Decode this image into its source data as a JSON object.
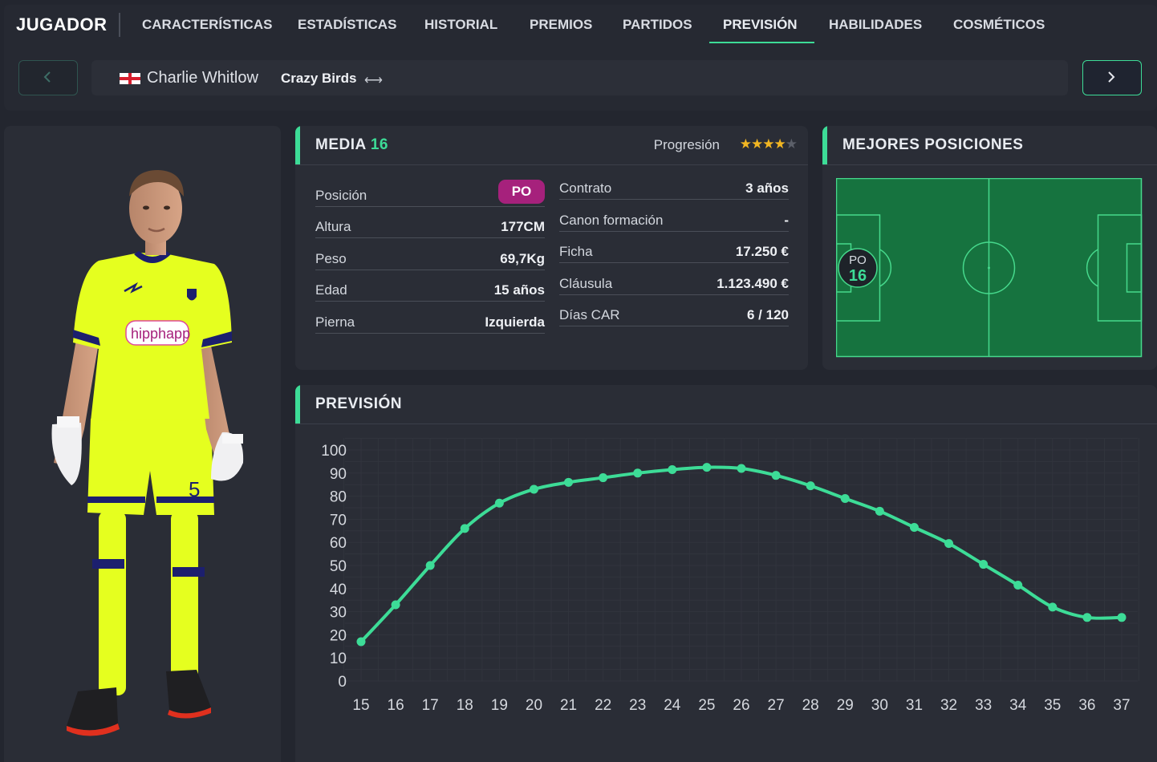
{
  "nav": {
    "title": "JUGADOR",
    "tabs": [
      {
        "label": "CARACTERÍSTICAS"
      },
      {
        "label": "ESTADÍSTICAS"
      },
      {
        "label": "HISTORIAL"
      },
      {
        "label": "PREMIOS"
      },
      {
        "label": "PARTIDOS"
      },
      {
        "label": "PREVISIÓN",
        "active": true
      },
      {
        "label": "HABILIDADES"
      },
      {
        "label": "COSMÉTICOS"
      }
    ]
  },
  "player": {
    "name": "Charlie Whitlow",
    "team": "Crazy Birds",
    "flag": "england-flag",
    "swap_icon": "⟷",
    "kit": {
      "number": "5",
      "sponsor": "hipphapp",
      "shirt_color": "#e5ff1f",
      "trim_color": "#1c1f6e"
    }
  },
  "media": {
    "title": "MEDIA",
    "value": "16",
    "progression_label": "Progresión",
    "stars_filled": 4,
    "stars_total": 5,
    "left_rows": [
      {
        "label": "Posición",
        "value": "PO"
      },
      {
        "label": "Altura",
        "value": "177CM"
      },
      {
        "label": "Peso",
        "value": "69,7Kg"
      },
      {
        "label": "Edad",
        "value": "15 años"
      },
      {
        "label": "Pierna",
        "value": "Izquierda"
      }
    ],
    "right_rows": [
      {
        "label": "Contrato",
        "value": "3 años"
      },
      {
        "label": "Canon formación",
        "value": "-"
      },
      {
        "label": "Ficha",
        "value": "17.250 €"
      },
      {
        "label": "Cláusula",
        "value": "1.123.490 €"
      },
      {
        "label": "Días CAR",
        "value": "6 / 120"
      }
    ]
  },
  "best_positions": {
    "title": "MEJORES POSICIONES",
    "marker": {
      "position": "PO",
      "value": "16"
    }
  },
  "forecast": {
    "title": "PREVISIÓN"
  },
  "colors": {
    "accent": "#3ddc97",
    "pitch": "#16733f",
    "position_pill": "#a6217c",
    "star": "#f2b622"
  },
  "chart_data": {
    "type": "line",
    "title": "",
    "xlabel": "",
    "ylabel": "",
    "x": [
      15,
      16,
      17,
      18,
      19,
      20,
      21,
      22,
      23,
      24,
      25,
      26,
      27,
      28,
      29,
      30,
      31,
      32,
      33,
      34,
      35,
      36,
      37
    ],
    "series": [
      {
        "values": [
          17,
          33,
          50,
          66,
          77,
          83,
          86,
          88,
          90,
          91.5,
          92.5,
          92,
          89,
          84.5,
          79,
          73.5,
          66.5,
          59.5,
          50.5,
          41.5,
          32,
          27.5,
          27.5
        ]
      }
    ],
    "ylim": [
      0,
      100
    ],
    "yticks": [
      0,
      10,
      20,
      30,
      40,
      50,
      60,
      70,
      80,
      90,
      100
    ],
    "grid": true
  }
}
